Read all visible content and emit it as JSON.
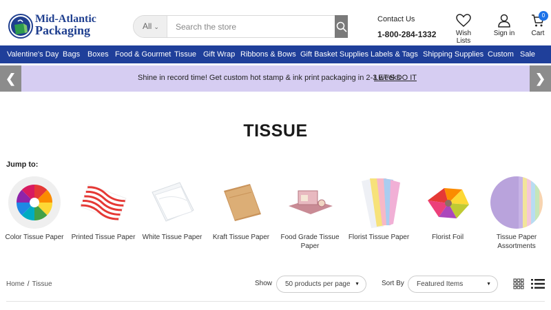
{
  "brand": {
    "line1": "Mid-Atlantic",
    "line2": "Packaging"
  },
  "search": {
    "category": "All",
    "placeholder": "Search the store"
  },
  "contact": {
    "label": "Contact Us",
    "phone": "1-800-284-1332"
  },
  "header_actions": {
    "wishlist": "Wish Lists",
    "signin": "Sign in",
    "cart": "Cart",
    "cart_count": "0"
  },
  "nav": [
    "Valentine's Day",
    "Bags",
    "Boxes",
    "Food & Gourmet",
    "Tissue",
    "Gift Wrap",
    "Ribbons & Bows",
    "Gift Basket Supplies",
    "Labels & Tags",
    "Shipping Supplies",
    "Custom",
    "Sale"
  ],
  "promo": {
    "text": "Shine in record time! Get custom hot stamp & ink print packaging in 2-3 weeks",
    "link": "LET'S DO IT"
  },
  "page_title": "TISSUE",
  "jump_to": "Jump to:",
  "categories": [
    {
      "label": "Color Tissue Paper",
      "icon": "color-wheel-icon"
    },
    {
      "label": "Printed Tissue Paper",
      "icon": "printed-tissue-icon"
    },
    {
      "label": "White Tissue Paper",
      "icon": "white-tissue-icon"
    },
    {
      "label": "Kraft Tissue Paper",
      "icon": "kraft-tissue-icon"
    },
    {
      "label": "Food Grade Tissue Paper",
      "icon": "food-grade-tissue-icon"
    },
    {
      "label": "Florist Tissue Paper",
      "icon": "florist-tissue-icon"
    },
    {
      "label": "Florist Foil",
      "icon": "florist-foil-icon"
    },
    {
      "label": "Tissue Paper Assortments",
      "icon": "tissue-assortment-icon"
    }
  ],
  "breadcrumb": {
    "home": "Home",
    "separator": "/",
    "current": "Tissue"
  },
  "toolbar": {
    "show_label": "Show",
    "show_value": "50 products per page",
    "sort_label": "Sort By",
    "sort_value": "Featured Items"
  },
  "colors": {
    "nav": "#1f3f9a",
    "promo": "#d6cdf2",
    "badge": "#1e73e8",
    "brand": "#1f3f8f"
  }
}
